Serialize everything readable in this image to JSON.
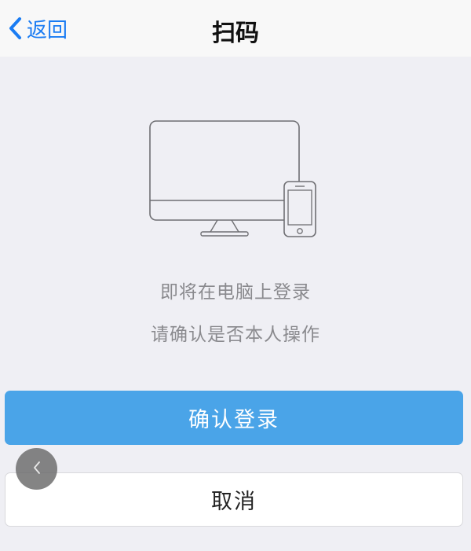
{
  "nav": {
    "back_label": "返回",
    "title": "扫码"
  },
  "message": {
    "line1": "即将在电脑上登录",
    "line2": "请确认是否本人操作"
  },
  "buttons": {
    "confirm_label": "确认登录",
    "cancel_label": "取消"
  },
  "icons": {
    "back": "chevron-left-icon",
    "illustration": "computer-phone-icon",
    "floating_back": "chevron-left-icon"
  },
  "colors": {
    "accent": "#1a7cf3",
    "confirm_bg": "#4aa4e8",
    "background": "#efeff4",
    "text_muted": "#8a8a8e"
  }
}
